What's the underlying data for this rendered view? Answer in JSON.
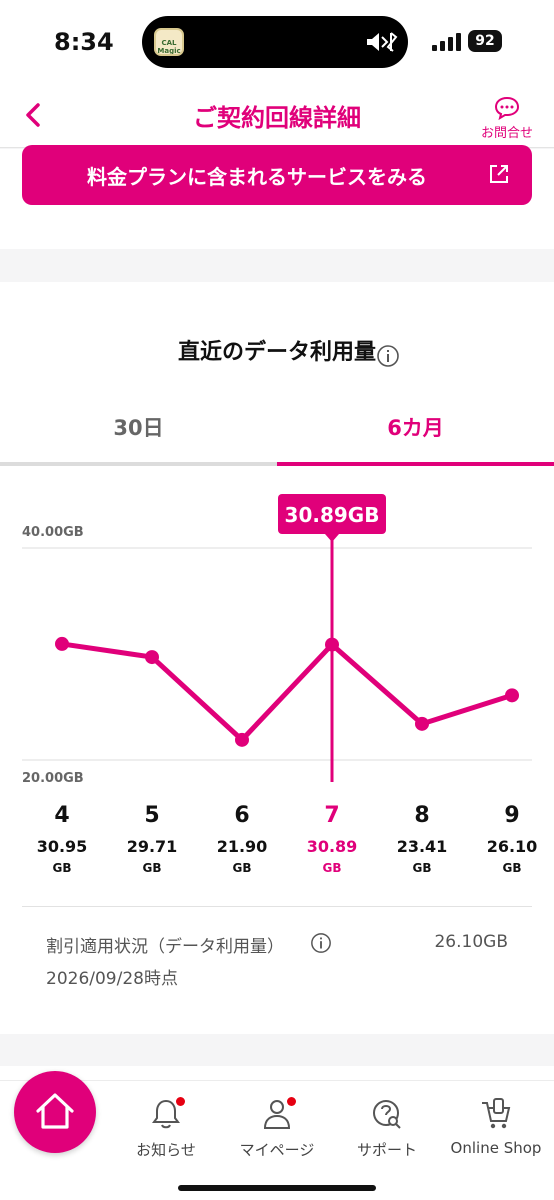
{
  "status_bar": {
    "time": "8:34",
    "battery": "92",
    "island_app": "CAL Magic"
  },
  "header": {
    "title": "ご契約回線詳細",
    "inquiry_label": "お問合せ"
  },
  "plan": {
    "button_label": "料金プランに含まれるサービスをみる"
  },
  "usage": {
    "title": "直近のデータ利用量",
    "tabs": [
      {
        "label": "30日",
        "active": false
      },
      {
        "label": "6カ月",
        "active": true
      }
    ],
    "tooltip": "30.89GB",
    "unit": "GB",
    "selected_index": 3,
    "discount_label": "割引適用状況（データ利用量）",
    "discount_value": "26.10GB",
    "discount_date": "2026/09/28時点"
  },
  "chart_data": {
    "type": "line",
    "categories": [
      "4",
      "5",
      "6",
      "7",
      "8",
      "9"
    ],
    "values": [
      30.95,
      29.71,
      21.9,
      30.89,
      23.41,
      26.1
    ],
    "value_labels": [
      "30.95",
      "29.71",
      "21.90",
      "30.89",
      "23.41",
      "26.10"
    ],
    "y_tick_labels": [
      "40.00GB",
      "20.00GB"
    ],
    "ylim": [
      20,
      40
    ],
    "grid": true,
    "accent_color": "#e0007a"
  },
  "bottom_nav": {
    "items": [
      {
        "label": "お知らせ",
        "icon": "bell-icon",
        "badge": true
      },
      {
        "label": "マイページ",
        "icon": "person-icon",
        "badge": true
      },
      {
        "label": "サポート",
        "icon": "support-icon",
        "badge": false
      },
      {
        "label": "Online Shop",
        "icon": "cart-icon",
        "badge": false
      }
    ]
  },
  "colors": {
    "accent": "#e0007a",
    "badge": "#e60012"
  }
}
